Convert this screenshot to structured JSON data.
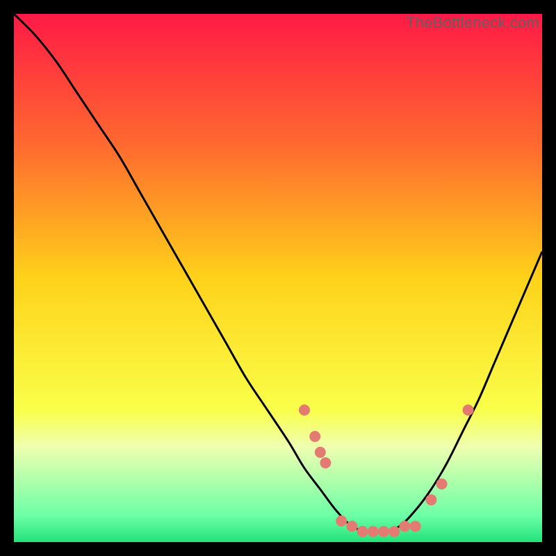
{
  "watermark": "TheBottleneck.com",
  "chart_data": {
    "type": "line",
    "title": "",
    "xlabel": "",
    "ylabel": "",
    "xlim": [
      0,
      100
    ],
    "ylim": [
      0,
      100
    ],
    "background_gradient": {
      "stops": [
        {
          "pos": 0.0,
          "color": "#ff1a46"
        },
        {
          "pos": 0.25,
          "color": "#ff6a2f"
        },
        {
          "pos": 0.5,
          "color": "#ffd21a"
        },
        {
          "pos": 0.75,
          "color": "#f9ff4a"
        },
        {
          "pos": 0.82,
          "color": "#efffb0"
        },
        {
          "pos": 0.95,
          "color": "#6cffa6"
        },
        {
          "pos": 1.0,
          "color": "#23e27a"
        }
      ]
    },
    "series": [
      {
        "name": "bottleneck-curve",
        "color": "#000000",
        "x": [
          0,
          4,
          8,
          12,
          16,
          20,
          24,
          28,
          32,
          36,
          40,
          44,
          48,
          52,
          55,
          58,
          61,
          64,
          67,
          70,
          73,
          76,
          79,
          82,
          85,
          88,
          91,
          94,
          97,
          100
        ],
        "y": [
          100,
          96,
          91,
          85,
          79,
          73,
          66,
          59,
          52,
          45,
          38,
          31,
          25,
          19,
          14,
          10,
          6,
          3,
          2,
          2,
          3,
          6,
          10,
          15,
          21,
          27,
          34,
          41,
          48,
          55
        ]
      }
    ],
    "markers": {
      "name": "highlight-dots",
      "color": "#e47b72",
      "radius": 8,
      "points": [
        {
          "x": 55,
          "y": 25
        },
        {
          "x": 57,
          "y": 20
        },
        {
          "x": 58,
          "y": 17
        },
        {
          "x": 59,
          "y": 15
        },
        {
          "x": 62,
          "y": 4
        },
        {
          "x": 64,
          "y": 3
        },
        {
          "x": 66,
          "y": 2
        },
        {
          "x": 68,
          "y": 2
        },
        {
          "x": 70,
          "y": 2
        },
        {
          "x": 72,
          "y": 2
        },
        {
          "x": 74,
          "y": 3
        },
        {
          "x": 76,
          "y": 3
        },
        {
          "x": 79,
          "y": 8
        },
        {
          "x": 81,
          "y": 11
        },
        {
          "x": 86,
          "y": 25
        }
      ]
    }
  }
}
